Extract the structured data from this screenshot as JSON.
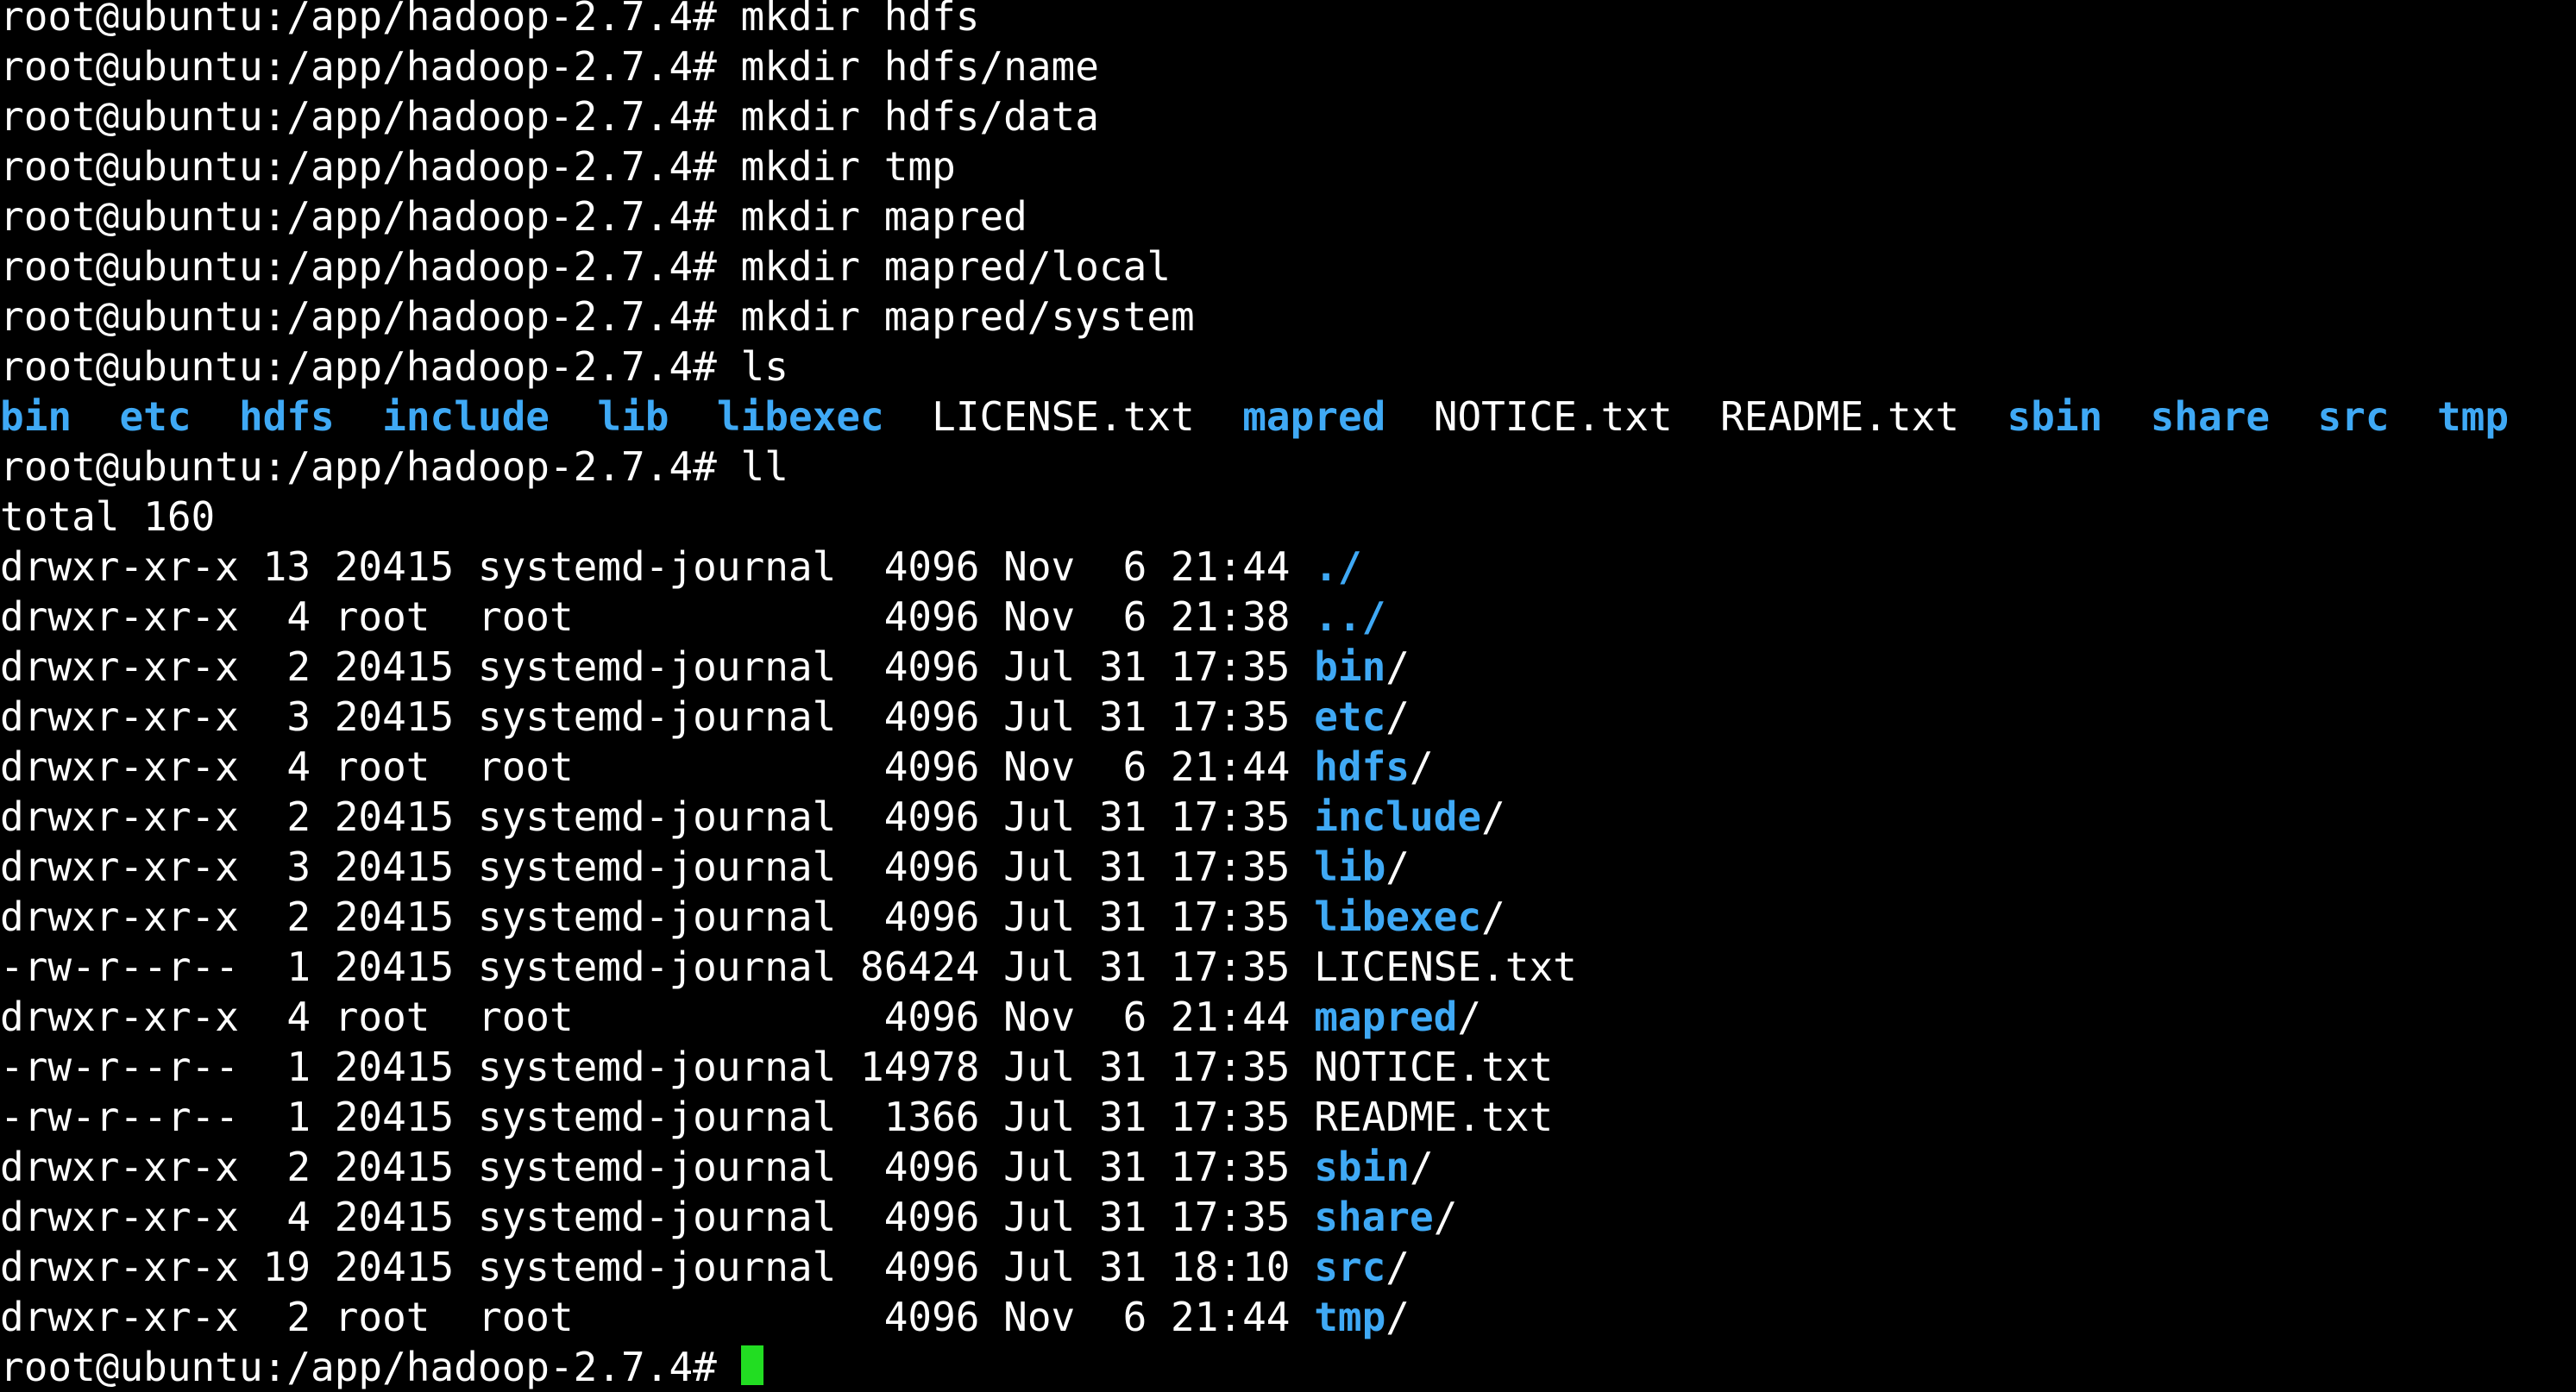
{
  "prompt": "root@ubuntu:/app/hadoop-2.7.4# ",
  "commands": [
    "mkdir hdfs",
    "mkdir hdfs/name",
    "mkdir hdfs/data",
    "mkdir tmp",
    "mkdir mapred",
    "mkdir mapred/local",
    "mkdir mapred/system",
    "ls"
  ],
  "ls_output": [
    {
      "name": "bin",
      "type": "dir"
    },
    {
      "name": "etc",
      "type": "dir"
    },
    {
      "name": "hdfs",
      "type": "dir"
    },
    {
      "name": "include",
      "type": "dir"
    },
    {
      "name": "lib",
      "type": "dir"
    },
    {
      "name": "libexec",
      "type": "dir"
    },
    {
      "name": "LICENSE.txt",
      "type": "file"
    },
    {
      "name": "mapred",
      "type": "dir"
    },
    {
      "name": "NOTICE.txt",
      "type": "file"
    },
    {
      "name": "README.txt",
      "type": "file"
    },
    {
      "name": "sbin",
      "type": "dir"
    },
    {
      "name": "share",
      "type": "dir"
    },
    {
      "name": "src",
      "type": "dir"
    },
    {
      "name": "tmp",
      "type": "dir"
    }
  ],
  "ll_command": "ll",
  "total_line": "total 160",
  "ll_rows": [
    {
      "meta": "drwxr-xr-x 13 20415 systemd-journal  4096 Nov  6 21:44 ",
      "name": "./",
      "type": "dir"
    },
    {
      "meta": "drwxr-xr-x  4 root  root             4096 Nov  6 21:38 ",
      "name": "../",
      "type": "dir"
    },
    {
      "meta": "drwxr-xr-x  2 20415 systemd-journal  4096 Jul 31 17:35 ",
      "name": "bin",
      "suffix": "/",
      "type": "dir"
    },
    {
      "meta": "drwxr-xr-x  3 20415 systemd-journal  4096 Jul 31 17:35 ",
      "name": "etc",
      "suffix": "/",
      "type": "dir"
    },
    {
      "meta": "drwxr-xr-x  4 root  root             4096 Nov  6 21:44 ",
      "name": "hdfs",
      "suffix": "/",
      "type": "dir"
    },
    {
      "meta": "drwxr-xr-x  2 20415 systemd-journal  4096 Jul 31 17:35 ",
      "name": "include",
      "suffix": "/",
      "type": "dir"
    },
    {
      "meta": "drwxr-xr-x  3 20415 systemd-journal  4096 Jul 31 17:35 ",
      "name": "lib",
      "suffix": "/",
      "type": "dir"
    },
    {
      "meta": "drwxr-xr-x  2 20415 systemd-journal  4096 Jul 31 17:35 ",
      "name": "libexec",
      "suffix": "/",
      "type": "dir"
    },
    {
      "meta": "-rw-r--r--  1 20415 systemd-journal 86424 Jul 31 17:35 ",
      "name": "LICENSE.txt",
      "suffix": "",
      "type": "file"
    },
    {
      "meta": "drwxr-xr-x  4 root  root             4096 Nov  6 21:44 ",
      "name": "mapred",
      "suffix": "/",
      "type": "dir"
    },
    {
      "meta": "-rw-r--r--  1 20415 systemd-journal 14978 Jul 31 17:35 ",
      "name": "NOTICE.txt",
      "suffix": "",
      "type": "file"
    },
    {
      "meta": "-rw-r--r--  1 20415 systemd-journal  1366 Jul 31 17:35 ",
      "name": "README.txt",
      "suffix": "",
      "type": "file"
    },
    {
      "meta": "drwxr-xr-x  2 20415 systemd-journal  4096 Jul 31 17:35 ",
      "name": "sbin",
      "suffix": "/",
      "type": "dir"
    },
    {
      "meta": "drwxr-xr-x  4 20415 systemd-journal  4096 Jul 31 17:35 ",
      "name": "share",
      "suffix": "/",
      "type": "dir"
    },
    {
      "meta": "drwxr-xr-x 19 20415 systemd-journal  4096 Jul 31 18:10 ",
      "name": "src",
      "suffix": "/",
      "type": "dir"
    },
    {
      "meta": "drwxr-xr-x  2 root  root             4096 Nov  6 21:44 ",
      "name": "tmp",
      "suffix": "/",
      "type": "dir"
    }
  ],
  "colors": {
    "background": "#000000",
    "text": "#ffffff",
    "directory": "#3fa9f5",
    "cursor": "#22dd22"
  }
}
